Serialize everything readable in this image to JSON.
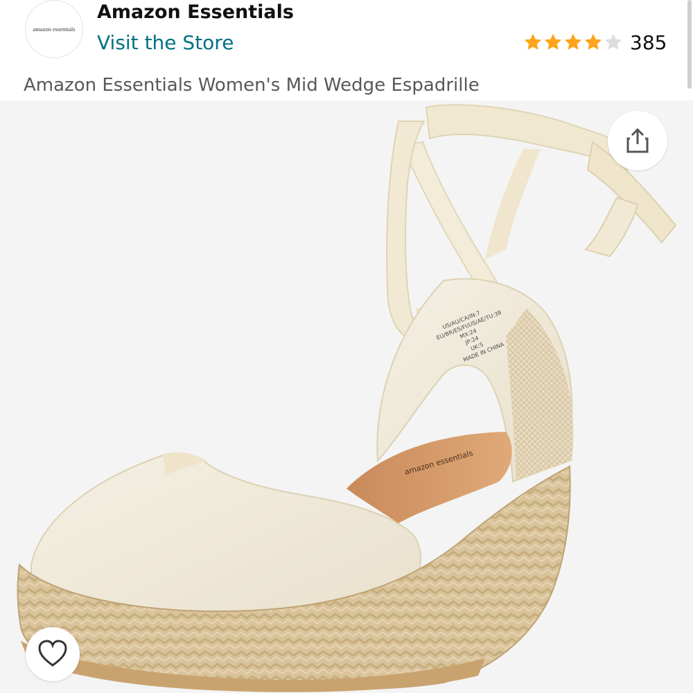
{
  "header": {
    "brand_logo_text": "amazon essentials",
    "brand_name": "Amazon Essentials",
    "store_link": "Visit the Store",
    "rating": {
      "stars": 4,
      "max_stars": 5,
      "count": "385",
      "star_color": "#ffa41c",
      "empty_star_color": "#dddddd"
    }
  },
  "product": {
    "title": "Amazon Essentials Women's Mid Wedge Espadrille",
    "image_alt": "Cream canvas lace-up mid wedge espadrille with jute sole",
    "insole_label": "amazon essentials",
    "size_label": {
      "line1": "US/AU/CA/IN:7",
      "line2": "EU/BR/ES/FI/US/AE/TU:38",
      "line3": "MX:24",
      "line4": "JP:24",
      "line5": "UK:5",
      "line6": "MADE IN CHINA"
    }
  },
  "actions": {
    "share_icon": "share-icon",
    "wishlist_icon": "heart-icon"
  },
  "colors": {
    "link": "#007185",
    "text": "#0f1111",
    "subtext": "#565959",
    "image_background": "#f4f4f4"
  }
}
